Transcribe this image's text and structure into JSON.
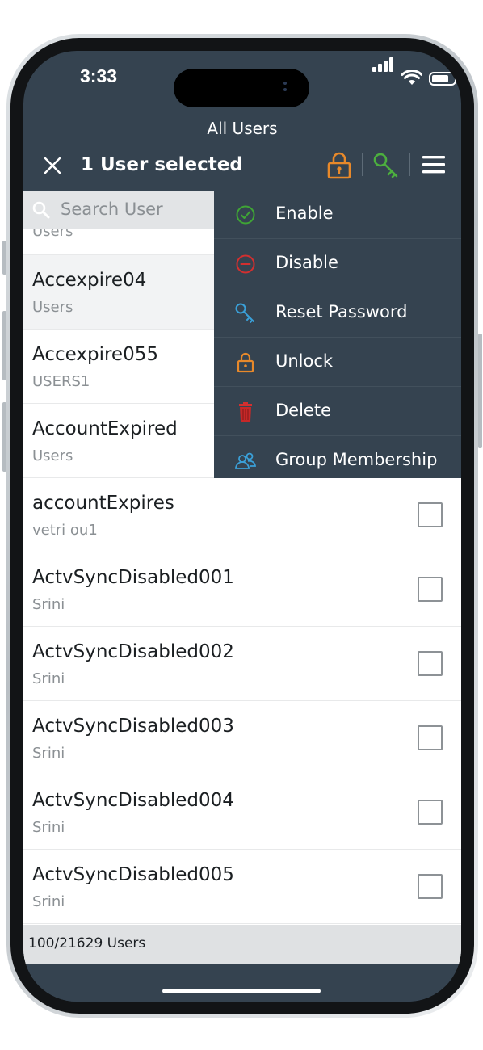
{
  "status_bar": {
    "time": "3:33"
  },
  "header": {
    "title": "All Users",
    "selected_text": "1 User selected"
  },
  "search": {
    "placeholder": "Search User"
  },
  "partial_row": {
    "subtitle": "Users"
  },
  "users": [
    {
      "name": "Accexpire04",
      "ou": "Users",
      "selected": true
    },
    {
      "name": "Accexpire055",
      "ou": "USERS1",
      "selected": false
    },
    {
      "name": "AccountExpired",
      "ou": "Users",
      "selected": false
    },
    {
      "name": "accountExpires",
      "ou": "vetri ou1",
      "selected": false
    },
    {
      "name": "ActvSyncDisabled001",
      "ou": "Srini",
      "selected": false
    },
    {
      "name": "ActvSyncDisabled002",
      "ou": "Srini",
      "selected": false
    },
    {
      "name": "ActvSyncDisabled003",
      "ou": "Srini",
      "selected": false
    },
    {
      "name": "ActvSyncDisabled004",
      "ou": "Srini",
      "selected": false
    },
    {
      "name": "ActvSyncDisabled005",
      "ou": "Srini",
      "selected": false
    }
  ],
  "menu": {
    "items": [
      {
        "label": "Enable",
        "icon": "check-circle-icon",
        "color": "#3fa535"
      },
      {
        "label": "Disable",
        "icon": "minus-circle-icon",
        "color": "#d32f2f"
      },
      {
        "label": "Reset Password",
        "icon": "key-icon",
        "color": "#3aa0d8"
      },
      {
        "label": "Unlock",
        "icon": "lock-icon",
        "color": "#e8892a"
      },
      {
        "label": "Delete",
        "icon": "trash-icon",
        "color": "#d32f2f"
      },
      {
        "label": "Group Membership",
        "icon": "group-icon",
        "color": "#3aa0d8"
      }
    ]
  },
  "footer": {
    "count_text": "100/21629 Users"
  },
  "colors": {
    "header_bg": "#354350",
    "unlock_orange": "#e8892a",
    "key_green": "#4caf3e"
  }
}
